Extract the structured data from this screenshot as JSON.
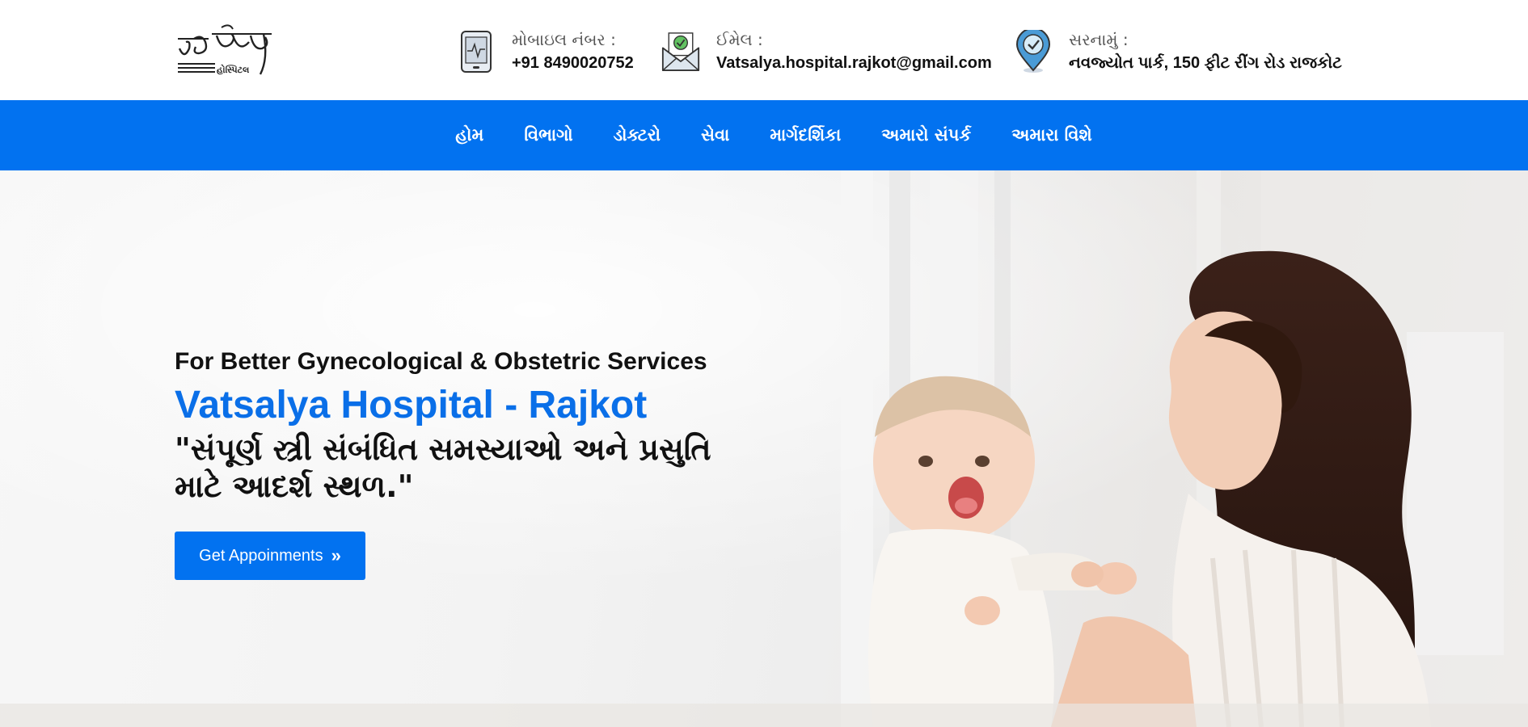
{
  "header": {
    "mobile": {
      "label": "મોબાઇલ નંબર :",
      "value": "+91 8490020752",
      "icon": "tablet-icon"
    },
    "email": {
      "label": "ઈમેલ :",
      "value": "Vatsalya.hospital.rajkot@gmail.com",
      "icon": "envelope-icon"
    },
    "address": {
      "label": "સરનામું :",
      "value": "નવજ્યોત પાર્ક, 150 ફીટ રીંગ રોડ રાજકોટ",
      "icon": "location-pin-icon"
    }
  },
  "nav": {
    "items": [
      {
        "label": "હોમ"
      },
      {
        "label": "વિભાગો"
      },
      {
        "label": "ડોક્ટરો"
      },
      {
        "label": "સેવા"
      },
      {
        "label": "માર્ગદર્શિકા"
      },
      {
        "label": "અમારો સંપર્ક"
      },
      {
        "label": "અમારા વિશે"
      }
    ]
  },
  "hero": {
    "subtitle": "For Better Gynecological & Obstetric Services",
    "title": "Vatsalya Hospital - Rajkot",
    "quote": "\"સંપૂર્ણ સ્ત્રી સંબંધિત સમસ્યાઓ અને પ્રસુતિ માટે આદર્શ સ્થળ.\"",
    "button_label": "Get Appoinments",
    "button_icon": "double-chevron-right-icon",
    "image": "mother-and-baby-photo"
  },
  "colors": {
    "primary": "#0272f0",
    "title_blue": "#0a6fe8",
    "text": "#111111"
  }
}
